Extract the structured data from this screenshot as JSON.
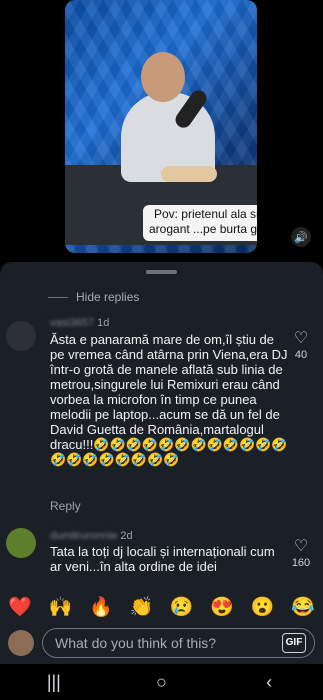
{
  "video": {
    "caption": "Pov: prietenul ala smecher si arogant ...pe burta goala 😅😅",
    "sound_icon": "speaker-icon"
  },
  "sheet": {
    "hide_replies": "Hide replies"
  },
  "comments": [
    {
      "username": "vasi3657",
      "time": "1d",
      "text": "Ăsta e panaramă mare de om,îl știu de pe vremea când atârna prin Viena,era DJ într-o grotă de manele aflată sub linia de metrou,singurele lui Remixuri erau când vorbea la microfon în timp ce punea melodii pe laptop...acum se dă un fel de David Guetta de România,martalogul dracu!!!🤣🤣🤣🤣🤣🤣🤣🤣🤣🤣🤣🤣🤣🤣🤣🤣🤣🤣🤣🤣",
      "reply": "Reply",
      "likes": "40"
    },
    {
      "username": "dumitruronnie",
      "time": "2d",
      "text": "Tata la toți dj locali și internaționali cum ar veni...în alta ordine de idei",
      "reply": "",
      "likes": "160"
    }
  ],
  "emoji_bar": [
    "❤️",
    "🙌",
    "🔥",
    "👏",
    "😢",
    "😍",
    "😮",
    "😂"
  ],
  "composer": {
    "placeholder": "What do you think of this?",
    "gif_label": "GIF"
  },
  "nav": [
    "|||",
    "○",
    "‹"
  ]
}
